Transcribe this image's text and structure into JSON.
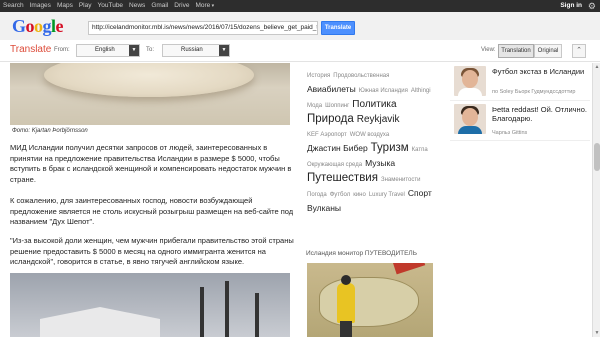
{
  "topbar": {
    "links": [
      "Search",
      "Images",
      "Maps",
      "Play",
      "YouTube",
      "News",
      "Gmail",
      "Drive",
      "More"
    ],
    "signin": "Sign in"
  },
  "header": {
    "url": "http://icelandmonitor.mbl.is/news/news/2016/07/15/dozens_believe_get_paid_to",
    "translate_button": "Translate"
  },
  "toolbar": {
    "title": "Translate",
    "from_label": "From:",
    "from_value": "English",
    "to_label": "To:",
    "to_value": "Russian",
    "view_label": "View:",
    "view_translation": "Translation",
    "view_original": "Original"
  },
  "article": {
    "photo_caption": "Фото: Kjartan Þorbjörnsson",
    "p1": "МИД Исландии получил десятки запросов от людей, заинтересованных в принятии на предложение правительства Исландии в размере $ 5000, чтобы вступить в брак с исландской женщиной и компенсировать недостаток мужчин в стране.",
    "p2": "К сожалению, для заинтересованных господ, новости возбуждающей предложение является не столь искусный розыгрыш размещен на веб-сайте под названием \"Дух Шепот\".",
    "p3": "\"Из-за высокой доли женщин, чем мужчин прибегали правительство этой страны решение предоставить $ 5000 в месяц на одного иммигранта женится на исландской\", говорится в статье, в явно тягучей английском языке."
  },
  "tags": [
    {
      "text": "История",
      "size": "s"
    },
    {
      "text": "Продовольственная",
      "size": "s"
    },
    {
      "text": "Авиабилеты",
      "size": "m"
    },
    {
      "text": "Южная Исландия",
      "size": "s"
    },
    {
      "text": "Althingi",
      "size": "s"
    },
    {
      "text": "Мода",
      "size": "s"
    },
    {
      "text": "Шоппинг",
      "size": "s"
    },
    {
      "text": "Политика",
      "size": "l"
    },
    {
      "text": "Природа",
      "size": "xl"
    },
    {
      "text": "Reykjavik",
      "size": "l"
    },
    {
      "text": "KEF Аэропорт",
      "size": "s"
    },
    {
      "text": "WOW воздуха",
      "size": "s"
    },
    {
      "text": "Джастин Бибер",
      "size": "m"
    },
    {
      "text": "Туризм",
      "size": "xl"
    },
    {
      "text": "Катпа",
      "size": "s"
    },
    {
      "text": "Окружающая среда",
      "size": "s"
    },
    {
      "text": "Музыка",
      "size": "m"
    },
    {
      "text": "Путешествия",
      "size": "xl"
    },
    {
      "text": "Знаменитости",
      "size": "s"
    },
    {
      "text": "Погода",
      "size": "s"
    },
    {
      "text": "Футбол",
      "size": "s"
    },
    {
      "text": "кино",
      "size": "s"
    },
    {
      "text": "Luxury Travel",
      "size": "s"
    },
    {
      "text": "Спорт",
      "size": "m"
    },
    {
      "text": "Вулканы",
      "size": "m"
    }
  ],
  "tag_colors": {
    "small": "#888888",
    "big": "#222222"
  },
  "news": [
    {
      "title": "Футбол экстаз в Исландии",
      "meta": "по Soley Бьорк Гудмундссдоттир",
      "thumb_color": "#ffffff"
    },
    {
      "title": "Þetta reddast! Ой. Отлично. Благодарю.",
      "meta": "Чарльз Gittins",
      "thumb_color": "#1e6ea8"
    }
  ],
  "guide": {
    "title": "Исландия монитор ПУТЕВОДИТЕЛЬ"
  }
}
